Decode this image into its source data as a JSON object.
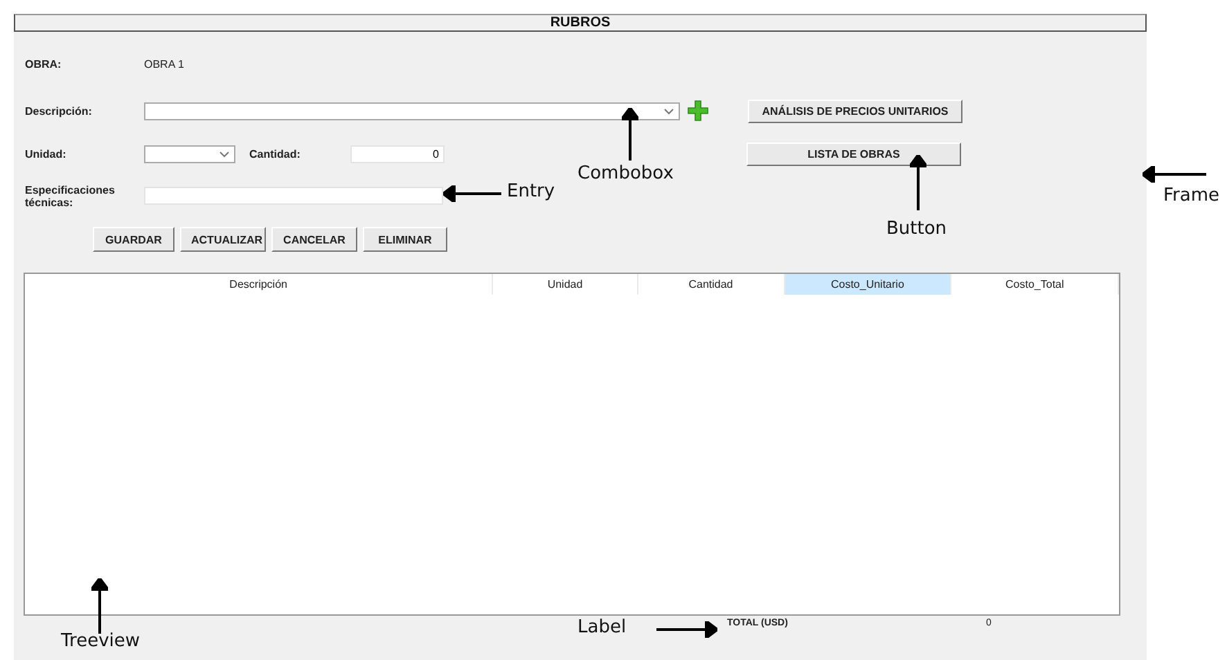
{
  "title": "RUBROS",
  "form": {
    "obra_label": "OBRA:",
    "obra_value": "OBRA 1",
    "descripcion_label": "Descripción:",
    "unidad_label": "Unidad:",
    "cantidad_label": "Cantidad:",
    "cantidad_value": "0",
    "especificaciones_label": "Especificaciones técnicas:"
  },
  "side_buttons": [
    "ANÁLISIS DE PRECIOS UNITARIOS",
    "LISTA DE OBRAS"
  ],
  "action_buttons": [
    "GUARDAR",
    "ACTUALIZAR",
    "CANCELAR",
    "ELIMINAR"
  ],
  "table": {
    "columns": [
      {
        "label": "Descripción",
        "highlighted": false
      },
      {
        "label": "Unidad",
        "highlighted": false
      },
      {
        "label": "Cantidad",
        "highlighted": false
      },
      {
        "label": "Costo_Unitario",
        "highlighted": true
      },
      {
        "label": "Costo_Total",
        "highlighted": false
      }
    ]
  },
  "total": {
    "label": "TOTAL (USD)",
    "value": "0"
  },
  "annotations": [
    {
      "text": "Combobox",
      "kind": "up"
    },
    {
      "text": "Entry",
      "kind": "left"
    },
    {
      "text": "Button",
      "kind": "up"
    },
    {
      "text": "Frame",
      "kind": "left"
    },
    {
      "text": "Treeview",
      "kind": "up"
    },
    {
      "text": "Label",
      "kind": "right"
    }
  ]
}
